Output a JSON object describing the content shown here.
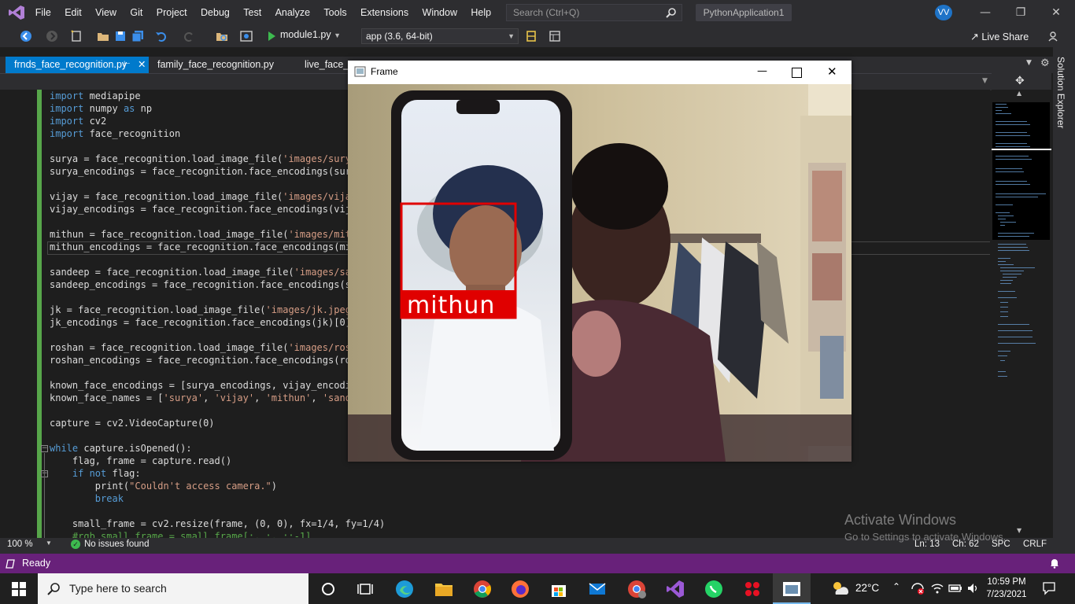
{
  "menubar": {
    "items": [
      "File",
      "Edit",
      "View",
      "Git",
      "Project",
      "Debug",
      "Test",
      "Analyze",
      "Tools",
      "Extensions",
      "Window",
      "Help"
    ],
    "search_placeholder": "Search (Ctrl+Q)",
    "solution_name": "PythonApplication1",
    "user_initials": "VV"
  },
  "toolbar": {
    "run_target": "module1.py",
    "environment": "app (3.6, 64-bit)",
    "live_share_label": "Live Share"
  },
  "tabs": [
    {
      "label": "frnds_face_recognition.py",
      "active": true
    },
    {
      "label": "family_face_recognition.py",
      "active": false
    },
    {
      "label": "live_face_r",
      "active": false
    }
  ],
  "side_panel": {
    "label": "Solution Explorer"
  },
  "editor": {
    "lines": [
      [
        [
          "id",
          "import mediapipe"
        ]
      ],
      [
        [
          "id",
          "import numpy as np"
        ]
      ],
      [
        [
          "id",
          "import cv2"
        ]
      ],
      [
        [
          "id",
          "import face_recognition"
        ]
      ],
      [],
      [
        [
          "t",
          "surya = face_recognition.load_image_file("
        ],
        [
          "s",
          "'images/surya"
        ]
      ],
      [
        [
          "t",
          "surya_encodings = face_recognition.face_encodings(sury"
        ]
      ],
      [],
      [
        [
          "t",
          "vijay = face_recognition.load_image_file("
        ],
        [
          "s",
          "'images/vijay"
        ]
      ],
      [
        [
          "t",
          "vijay_encodings = face_recognition.face_encodings(vija"
        ]
      ],
      [],
      [
        [
          "t",
          "mithun = face_recognition.load_image_file("
        ],
        [
          "s",
          "'images/mith"
        ]
      ],
      [
        [
          "t",
          "mithun_encodings = face_recognition.face_encodings(mit"
        ]
      ],
      [],
      [
        [
          "t",
          "sandeep = face_recognition.load_image_file("
        ],
        [
          "s",
          "'images/san"
        ]
      ],
      [
        [
          "t",
          "sandeep_encodings = face_recognition.face_encodings(sa"
        ]
      ],
      [],
      [
        [
          "t",
          "jk = face_recognition.load_image_file("
        ],
        [
          "s",
          "'images/jk.jpeg'"
        ]
      ],
      [
        [
          "t",
          "jk_encodings = face_recognition.face_encodings(jk)[0]"
        ]
      ],
      [],
      [
        [
          "t",
          "roshan = face_recognition.load_image_file("
        ],
        [
          "s",
          "'images/rosh"
        ]
      ],
      [
        [
          "t",
          "roshan_encodings = face_recognition.face_encodings(ros"
        ]
      ],
      [],
      [
        [
          "t",
          "known_face_encodings = [surya_encodings, vijay_encodin"
        ]
      ],
      [
        [
          "t",
          "known_face_names = ["
        ],
        [
          "s",
          "'surya'"
        ],
        [
          "t",
          ", "
        ],
        [
          "s",
          "'vijay'"
        ],
        [
          "t",
          ", "
        ],
        [
          "s",
          "'mithun'"
        ],
        [
          "t",
          ", "
        ],
        [
          "s",
          "'sande"
        ]
      ],
      [],
      [
        [
          "t",
          "capture = cv2.VideoCapture(0)"
        ]
      ],
      [],
      [
        [
          "k",
          "while"
        ],
        [
          "t",
          " capture.isOpened():"
        ]
      ],
      [
        [
          "t",
          "    flag, frame = capture.read()"
        ]
      ],
      [
        [
          "t",
          "    "
        ],
        [
          "k",
          "if not"
        ],
        [
          "t",
          " flag:"
        ]
      ],
      [
        [
          "t",
          "        print("
        ],
        [
          "s",
          "\"Couldn't access camera.\""
        ],
        [
          "t",
          ")"
        ]
      ],
      [
        [
          "t",
          "        "
        ],
        [
          "k",
          "break"
        ]
      ],
      [],
      [
        [
          "t",
          "    small_frame = cv2.resize(frame, (0, 0), fx=1/4, fy=1/4)"
        ]
      ],
      [
        [
          "c",
          "    #rgb_small_frame = small_frame[:, :, ::-1]"
        ]
      ]
    ]
  },
  "editor_status": {
    "zoom": "100 %",
    "issues": "No issues found",
    "line": "Ln: 13",
    "col": "Ch: 62",
    "whitespace": "SPC",
    "line_ending": "CRLF"
  },
  "statusbar": {
    "state": "Ready"
  },
  "frame_window": {
    "title": "Frame",
    "detected_name": "mithun",
    "box_color": "#e00000"
  },
  "watermark": {
    "title": "Activate Windows",
    "subtitle": "Go to Settings to activate Windows."
  },
  "taskbar": {
    "search_placeholder": "Type here to search",
    "weather": "22°C",
    "time": "10:59 PM",
    "date": "7/23/2021"
  }
}
